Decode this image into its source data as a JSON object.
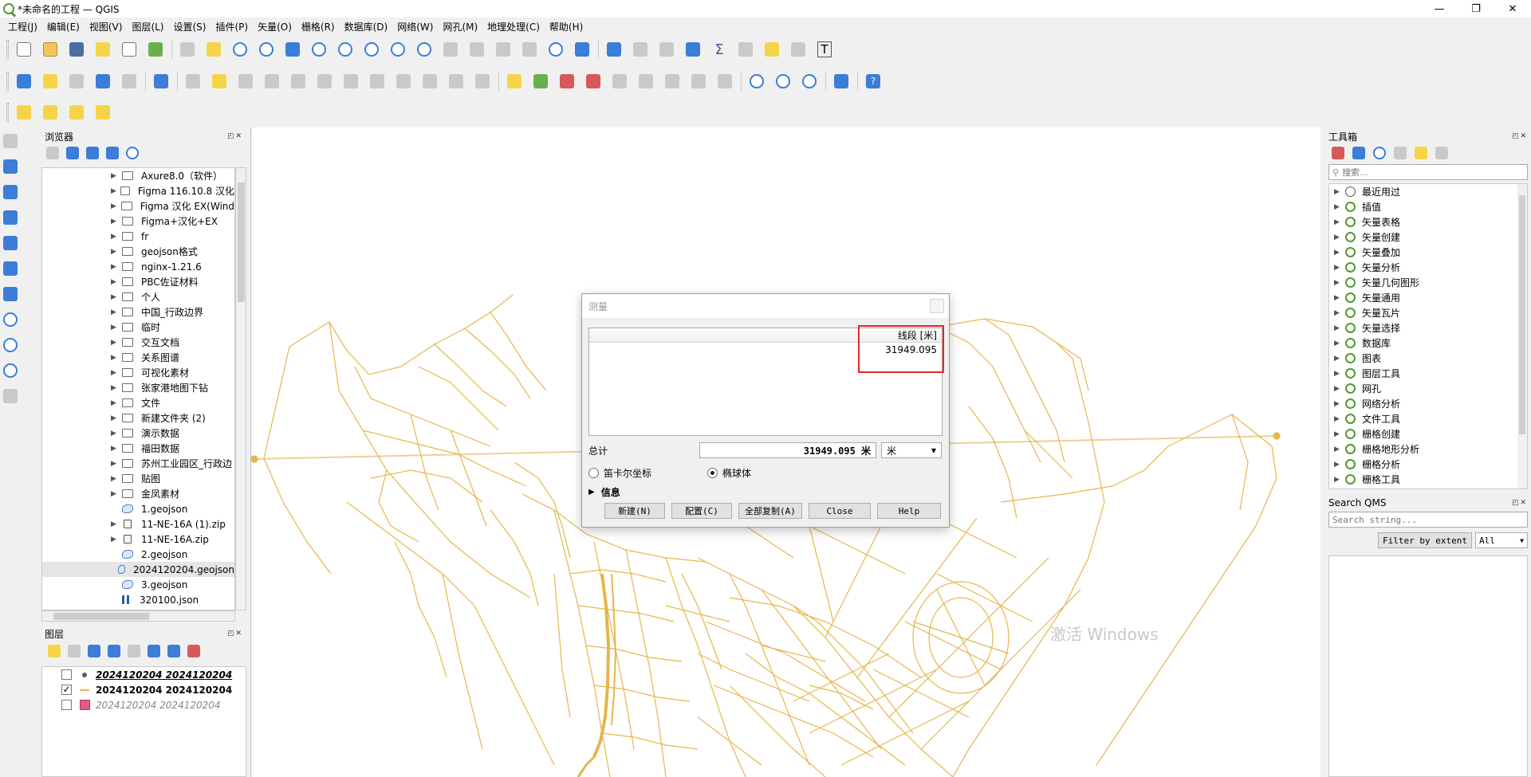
{
  "window": {
    "title": "*未命名的工程 — QGIS",
    "minimize": "—",
    "maximize": "❐",
    "close": "✕"
  },
  "menu": [
    "工程(J)",
    "编辑(E)",
    "视图(V)",
    "图层(L)",
    "设置(S)",
    "插件(P)",
    "矢量(O)",
    "栅格(R)",
    "数据库(D)",
    "网络(W)",
    "网孔(M)",
    "地理处理(C)",
    "帮助(H)"
  ],
  "browser": {
    "title": "浏览器",
    "items": [
      {
        "label": "Axure8.0（软件）",
        "type": "folder",
        "expandable": true
      },
      {
        "label": "Figma 116.10.8 汉化",
        "type": "folder",
        "expandable": true
      },
      {
        "label": "Figma 汉化 EX(Wind",
        "type": "folder",
        "expandable": true
      },
      {
        "label": "Figma+汉化+EX",
        "type": "folder",
        "expandable": true
      },
      {
        "label": "fr",
        "type": "folder",
        "expandable": true
      },
      {
        "label": "geojson格式",
        "type": "folder",
        "expandable": true
      },
      {
        "label": "nginx-1.21.6",
        "type": "folder",
        "expandable": true
      },
      {
        "label": "PBC佐证材料",
        "type": "folder",
        "expandable": true
      },
      {
        "label": "个人",
        "type": "folder",
        "expandable": true
      },
      {
        "label": "中国_行政边界",
        "type": "folder",
        "expandable": true
      },
      {
        "label": "临时",
        "type": "folder",
        "expandable": true
      },
      {
        "label": "交互文档",
        "type": "folder",
        "expandable": true
      },
      {
        "label": "关系图谱",
        "type": "folder",
        "expandable": true
      },
      {
        "label": "可视化素材",
        "type": "folder",
        "expandable": true
      },
      {
        "label": "张家港地图下钻",
        "type": "folder",
        "expandable": true
      },
      {
        "label": "文件",
        "type": "folder",
        "expandable": true
      },
      {
        "label": "新建文件夹 (2)",
        "type": "folder",
        "expandable": true
      },
      {
        "label": "演示数据",
        "type": "folder",
        "expandable": true
      },
      {
        "label": "福田数据",
        "type": "folder",
        "expandable": true
      },
      {
        "label": "苏州工业园区_行政边",
        "type": "folder",
        "expandable": true
      },
      {
        "label": "贴图",
        "type": "folder",
        "expandable": true
      },
      {
        "label": "金凤素材",
        "type": "folder",
        "expandable": true
      },
      {
        "label": "1.geojson",
        "type": "geo",
        "expandable": false
      },
      {
        "label": "11-NE-16A (1).zip",
        "type": "zip",
        "expandable": true
      },
      {
        "label": "11-NE-16A.zip",
        "type": "zip",
        "expandable": true
      },
      {
        "label": "2.geojson",
        "type": "geo",
        "expandable": false
      },
      {
        "label": "2024120204.geojson",
        "type": "geo",
        "expandable": false,
        "selected": true
      },
      {
        "label": "3.geojson",
        "type": "geo",
        "expandable": false
      },
      {
        "label": "320100.json",
        "type": "json",
        "expandable": false
      }
    ]
  },
  "layers": {
    "title": "图层",
    "items": [
      {
        "label": "2024120204 2024120204",
        "checked": false,
        "symbol": "point",
        "style": "italic-bold-underline"
      },
      {
        "label": "2024120204 2024120204",
        "checked": true,
        "symbol": "line",
        "style": "bold"
      },
      {
        "label": "2024120204 2024120204",
        "checked": false,
        "symbol": "polygon",
        "style": "italic-gray"
      }
    ]
  },
  "toolbox": {
    "title": "工具箱",
    "search_placeholder": "搜索...",
    "items": [
      "最近用过",
      "插值",
      "矢量表格",
      "矢量创建",
      "矢量叠加",
      "矢量分析",
      "矢量几何图形",
      "矢量通用",
      "矢量瓦片",
      "矢量选择",
      "数据库",
      "图表",
      "图层工具",
      "网孔",
      "网络分析",
      "文件工具",
      "栅格创建",
      "栅格地形分析",
      "栅格分析",
      "栅格工具"
    ]
  },
  "qms": {
    "title": "Search QMS",
    "search_placeholder": "Search string...",
    "filter_button": "Filter by extent",
    "filter_value": "All"
  },
  "measure": {
    "title": "测量",
    "column_header": "线段 [米]",
    "segment_value": "31949.095",
    "total_label": "总计",
    "total_value": "31949.095 米",
    "unit": "米",
    "radio_cartesian": "笛卡尔坐标",
    "radio_ellipsoidal": "椭球体",
    "info_label": "信息",
    "buttons": [
      "新建(N)",
      "配置(C)",
      "全部复制(A)",
      "Close",
      "Help"
    ]
  },
  "watermark": "激活 Windows",
  "colors": {
    "road": "#e6b64c",
    "highlight_box": "#e22828",
    "qgis_green": "#589632"
  }
}
